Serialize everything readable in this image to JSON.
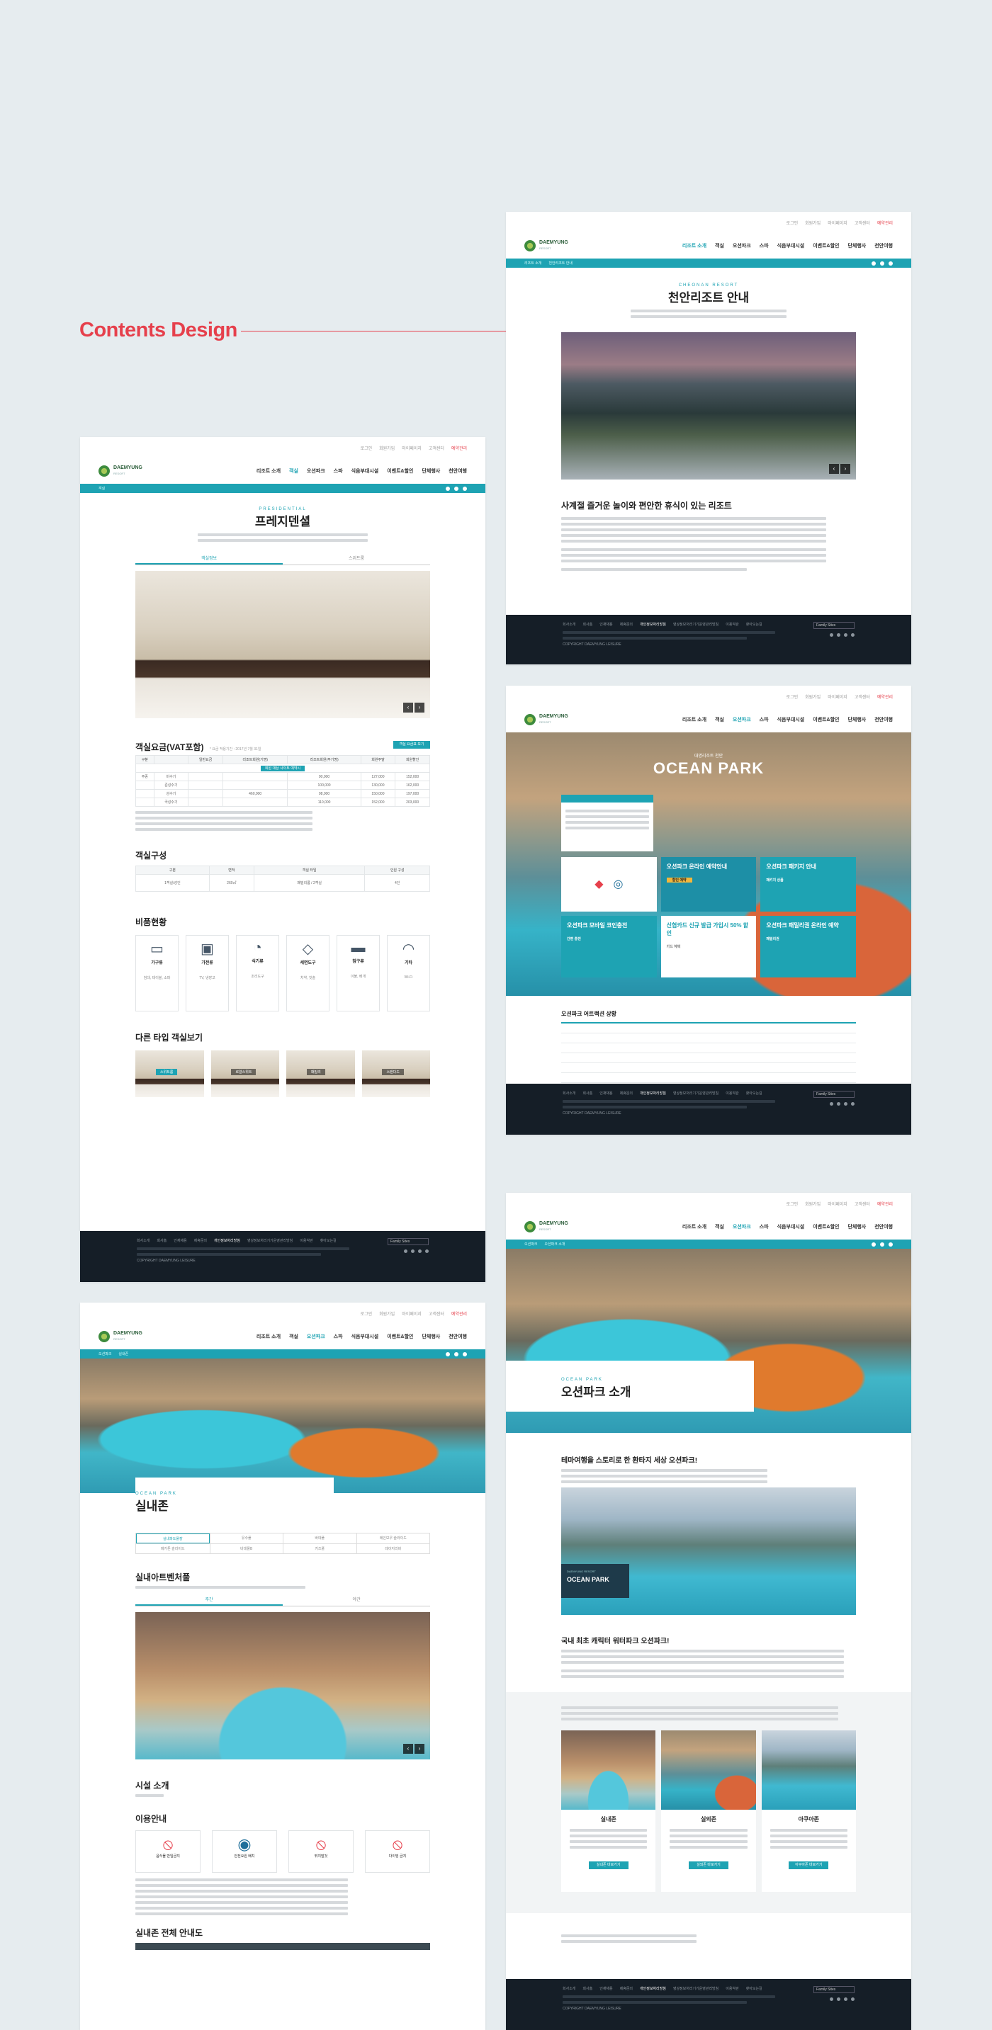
{
  "heading": "Contents Design",
  "common": {
    "top_links": [
      "로그인",
      "회원가입",
      "마이페이지",
      "고객센터",
      "예약관리"
    ],
    "logo_name": "DAEMYUNG",
    "logo_sub": "RESORT",
    "menu": [
      "리조트 소개",
      "객실",
      "오션파크",
      "스파",
      "식음부대시설",
      "이벤트&할인",
      "단체행사",
      "천안여행"
    ],
    "footer_links": [
      "회사소개",
      "회사홈",
      "인재채용",
      "제휴문의",
      "개인정보처리방침",
      "영상정보처리기기운영관리방침",
      "이용약관",
      "찾아오는길"
    ],
    "footer_family": "Family Sites",
    "footer_copy": "COPYRIGHT DAEMYUNG LEISURE"
  },
  "page_suite": {
    "title_en": "PRESIDENTIAL",
    "title": "프레지덴셜",
    "tabs": [
      "객실정보",
      "스위트룸"
    ],
    "rate_title": "객실요금(VAT포함)",
    "rate_note": "* 요금 적용기간 : 2017년 7월 31일",
    "rate_btn": "객실 요금표 보기",
    "rate_headers": [
      "구분",
      "",
      "일반요금",
      "리조트회원(기명)",
      "리조트회원(무기명)",
      "회원주말",
      "회원할인"
    ],
    "rate_rows": [
      [
        "주중",
        "비수기",
        "",
        "",
        "90,000",
        "127,000",
        "152,000"
      ],
      [
        "",
        "준성수기",
        "",
        "",
        "100,000",
        "130,000",
        "162,000"
      ],
      [
        "",
        "성수기",
        "",
        "460,000",
        "98,000",
        "150,000",
        "197,000"
      ],
      [
        "",
        "극성수기",
        "",
        "",
        "110,000",
        "152,000",
        "203,000"
      ]
    ],
    "rate_highlight": "회원 대상 사이트 예약시",
    "config_title": "객실구성",
    "config_headers": [
      "구분",
      "면적",
      "객실 타입",
      "인원 구성"
    ],
    "config_row": [
      "1객실/성인",
      "260㎡",
      "패밀리룸 / 2객실",
      "4인"
    ],
    "amenity_title": "비품현황",
    "amenities": [
      {
        "icon": "sofa-icon",
        "name": "가구류",
        "desc": "침대, 테이블, 소파"
      },
      {
        "icon": "tv-icon",
        "name": "가전류",
        "desc": "TV, 냉장고"
      },
      {
        "icon": "dish-icon",
        "name": "식기류",
        "desc": "조리도구"
      },
      {
        "icon": "bath-icon",
        "name": "세면도구",
        "desc": "치약, 칫솔"
      },
      {
        "icon": "bed-icon",
        "name": "침구류",
        "desc": "이불, 베개"
      },
      {
        "icon": "wifi-icon",
        "name": "기타",
        "desc": "Wi-Fi"
      }
    ],
    "other_title": "다른 타입 객실보기",
    "other_rooms": [
      "스위트룸",
      "로얄스위트",
      "패밀리",
      "스탠다드"
    ]
  },
  "page_resort": {
    "title_en": "CHEONAN RESORT",
    "title": "천안리조트 안내",
    "section": "사계절 즐거운 놀이와 편안한 휴식이 있는 리조트"
  },
  "page_ocean": {
    "hero_small": "대명리조트 천안",
    "hero_title": "OCEAN PARK",
    "tiles": [
      {
        "label": "오션파크 온라인 예약안내",
        "sub": "할인 예약"
      },
      {
        "label": "오션파크 패키지 안내",
        "sub": "패키지 상품"
      },
      {
        "label": "오션파크 모바일 코인충전",
        "sub": "간편 충전"
      },
      {
        "label": "신협카드 신규 발급 가입시 50% 할인",
        "sub": "카드 혜택"
      },
      {
        "label": "오션파크 패밀리권 온라인 예약",
        "sub": "패밀리권"
      }
    ],
    "status_title": "오션파크 어트랙션 상황"
  },
  "page_indoor": {
    "title_en": "OCEAN PARK",
    "title": "실내존",
    "tabs": [
      "실내파도풀장",
      "유수풀",
      "바데풀",
      "레인보우 슬라이드",
      "메가톤 슬라이드",
      "바데풀B",
      "키즈풀",
      "레이지리버"
    ],
    "sub_title": "실내아트벤처풀",
    "view_tabs": [
      "주간",
      "야간"
    ],
    "facility_title": "시설 소개",
    "guide_title": "이용안내",
    "guide_icons": [
      {
        "icon": "no-food-icon",
        "name": "음식물 반입금지"
      },
      {
        "icon": "guard-icon",
        "name": "안전요원 배치"
      },
      {
        "icon": "no-run-icon",
        "name": "뛰지말것"
      },
      {
        "icon": "no-diving-icon",
        "name": "다이빙 금지"
      }
    ],
    "map_title": "실내존 전체 안내도"
  },
  "page_intro": {
    "title_en": "OCEAN PARK",
    "title": "오션파크 소개",
    "headline": "테마여행을 스토리로 한 환타지 세상 오션파크!",
    "badge_small": "DAEMYUNG RESORT",
    "badge_title": "OCEAN PARK",
    "headline2": "국내 최초 캐릭터 워터파크 오션파크!",
    "zones": [
      {
        "name": "실내존",
        "btn": "실내존 바로가기"
      },
      {
        "name": "실외존",
        "btn": "실외존 바로가기"
      },
      {
        "name": "아쿠아존",
        "btn": "아쿠아존 바로가기"
      }
    ]
  }
}
